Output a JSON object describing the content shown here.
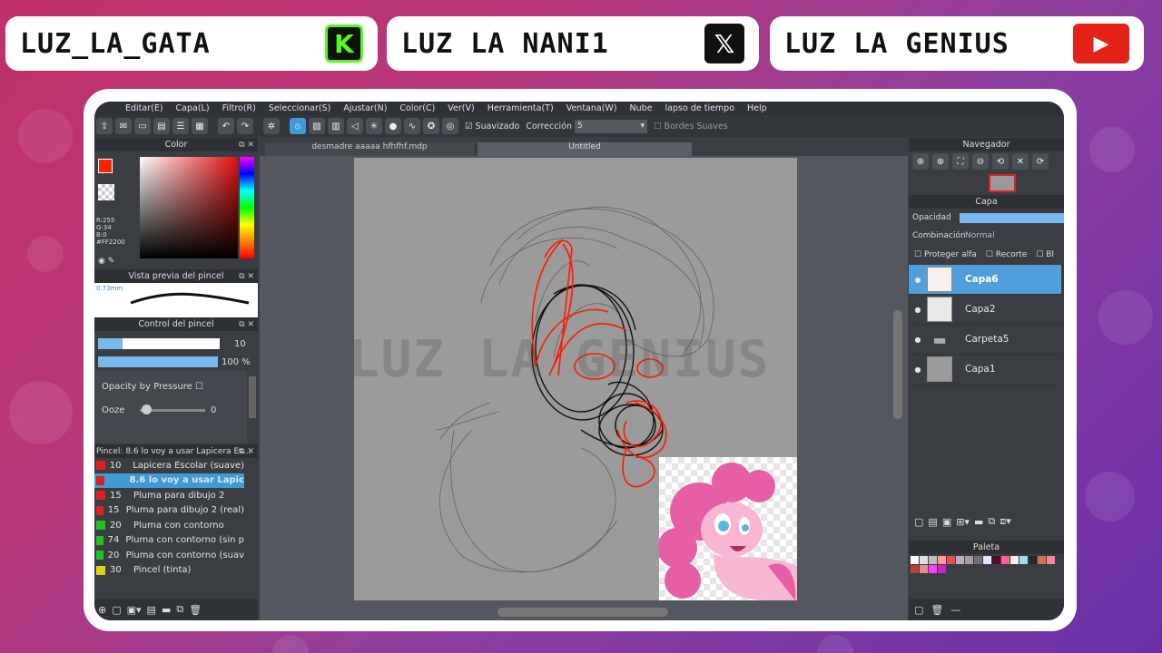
{
  "banners": [
    {
      "name": "LUZ_LA_GATA",
      "icon": "kick-icon",
      "icon_text": "K",
      "icon_bg": "#111111",
      "icon_fg": "#53fc18"
    },
    {
      "name": "LUZ LA NANI1",
      "icon": "x-icon",
      "icon_text": "𝕏",
      "icon_bg": "#111111",
      "icon_fg": "#ffffff"
    },
    {
      "name": "LUZ LA GENIUS",
      "icon": "youtube-icon",
      "icon_text": "▶",
      "icon_bg": "#e62117",
      "icon_fg": "#ffffff"
    }
  ],
  "menu": [
    "Editar(E)",
    "Capa(L)",
    "Filtro(R)",
    "Seleccionar(S)",
    "Ajustar(N)",
    "Color(C)",
    "Ver(V)",
    "Herramienta(T)",
    "Ventana(W)",
    "Nube",
    "lapso de tiempo",
    "Help"
  ],
  "toolbar": {
    "smoothing_label": "Suavizado",
    "correction_label": "Corrección",
    "correction_value": "5",
    "soft_edges_label": "Bordes Suaves"
  },
  "color_panel": {
    "title": "Color",
    "r": "R:255",
    "g": "G:34",
    "b": "B:0",
    "hex": "#FF2200",
    "primary": "#ff2200"
  },
  "brush_preview": {
    "title": "Vista previa del pincel",
    "size": "0.73mm"
  },
  "brush_control": {
    "title": "Control del pincel",
    "size_value": "10",
    "opacity_value": "100 %",
    "size_fill": 0.2,
    "opacity_fill": 1.0,
    "pressure_label": "Opacity by Pressure",
    "ooze_label": "Ooze",
    "ooze_value": "0"
  },
  "brush_list": {
    "title": "Pincel: 8.6 lo voy a usar Lapicera Es...",
    "items": [
      {
        "num": "10",
        "name": "Lapicera Escolar (suave)",
        "color": "#e02020"
      },
      {
        "num": "",
        "name": "8.6 lo voy a usar Lapic",
        "color": "#e02020",
        "selected": true
      },
      {
        "num": "15",
        "name": "Pluma para dibujo 2",
        "color": "#e02020"
      },
      {
        "num": "15",
        "name": "Pluma para dibujo 2 (real)",
        "color": "#e02020"
      },
      {
        "num": "20",
        "name": "Pluma con contorno",
        "color": "#22c022"
      },
      {
        "num": "74",
        "name": "Pluma con contorno (sin p",
        "color": "#22c022"
      },
      {
        "num": "20",
        "name": "Pluma con contorno (suav",
        "color": "#22c022"
      },
      {
        "num": "30",
        "name": "Pincel (tinta)",
        "color": "#e0d020"
      }
    ]
  },
  "tabs": [
    "desmadre aaaaa hfhfhf.mdp",
    "Untitled"
  ],
  "watermark": "LUZ LA GENIUS",
  "navigator": {
    "title": "Navegador"
  },
  "layer_panel": {
    "title": "Capa",
    "opacity_label": "Opacidad",
    "blend_label": "Combinación",
    "blend_value": "Normal",
    "protect_alpha": "Proteger alfa",
    "clipping": "Recorte",
    "extra": "Bl",
    "layers": [
      {
        "name": "Capa6",
        "selected": true
      },
      {
        "name": "Capa2",
        "selected": false
      },
      {
        "name": "Carpeta5",
        "selected": false,
        "folder": true
      },
      {
        "name": "Capa1",
        "selected": false
      }
    ]
  },
  "palette": {
    "title": "Paleta",
    "colors": [
      "#ffffff",
      "#e0e0e0",
      "#c0c0c0",
      "#ff9a9a",
      "#e85050",
      "#c8a8c8",
      "#a0a0a0",
      "#707070",
      "#e8e0ff",
      "#5a0a28",
      "#ff6090",
      "#f0f0f0",
      "#a8d8f0",
      "#2a2a2a",
      "#c87850",
      "#ff80a0",
      "#c04030",
      "#e09090",
      "#ff40ff",
      "#d020c0"
    ]
  }
}
